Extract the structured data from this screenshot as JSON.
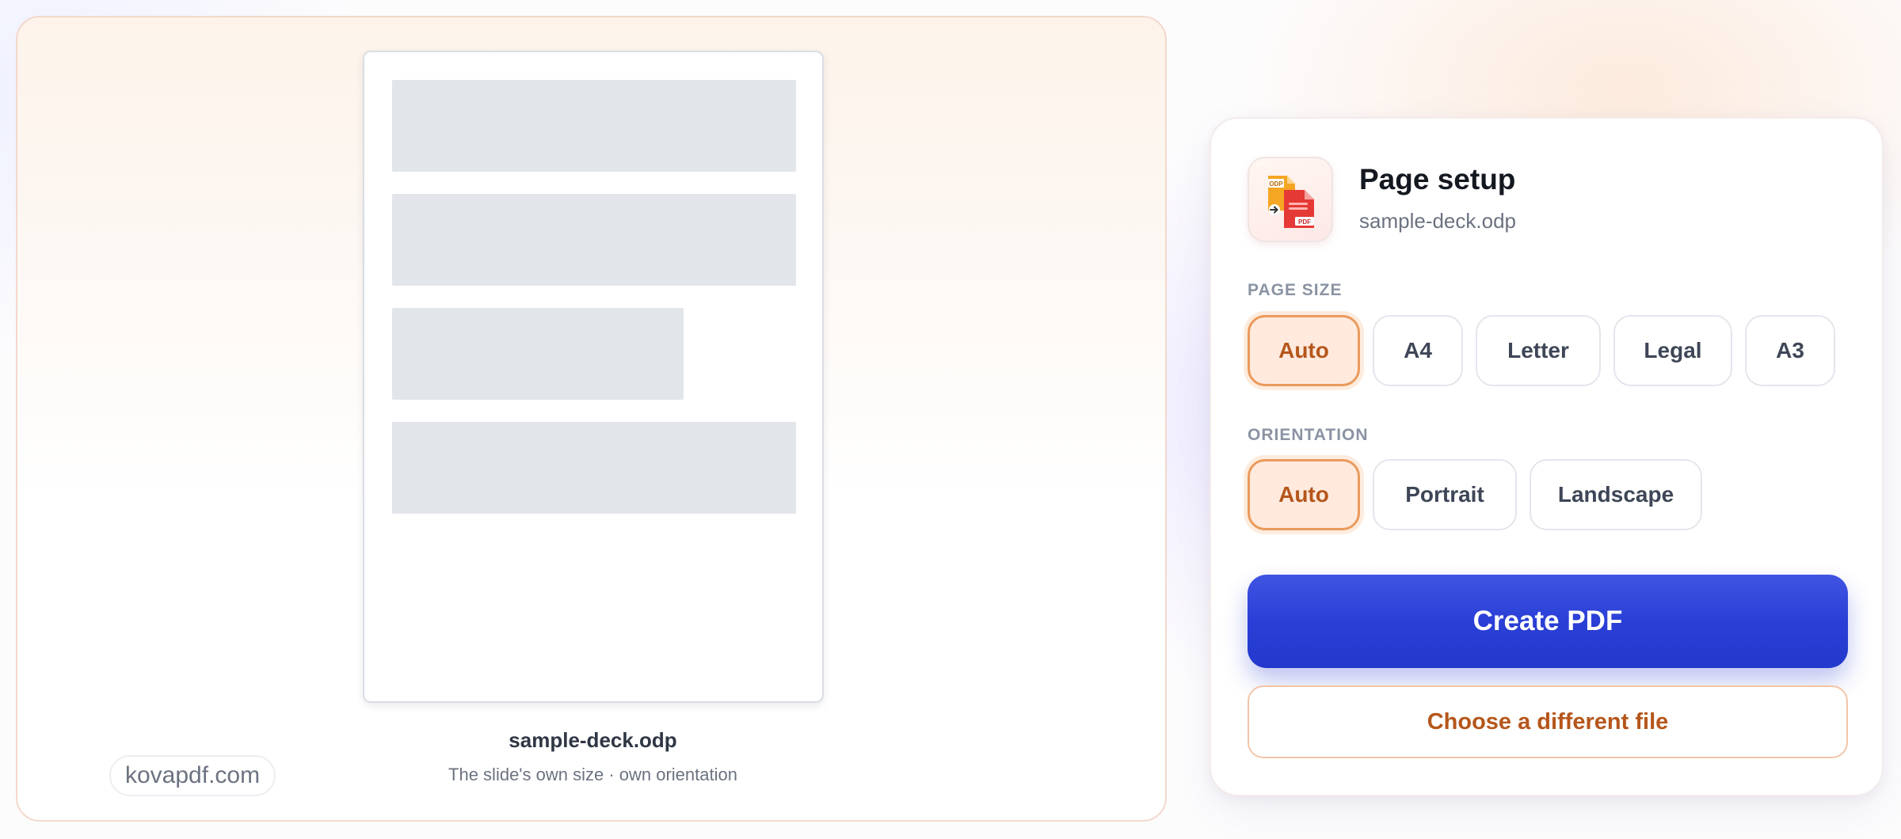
{
  "preview": {
    "filename": "sample-deck.odp",
    "subtitle": "The slide's own size · own orientation",
    "brand": "kovapdf.com"
  },
  "setup": {
    "title": "Page setup",
    "filename": "sample-deck.odp",
    "icon": {
      "name": "odp-to-pdf-icon",
      "source_badge": "ODP",
      "target_badge": "PDF",
      "colors": {
        "source": "#f5a623",
        "target": "#e53935"
      }
    },
    "page_size": {
      "label": "PAGE SIZE",
      "options": [
        "Auto",
        "A4",
        "Letter",
        "Legal",
        "A3"
      ],
      "selected": "Auto"
    },
    "orientation": {
      "label": "ORIENTATION",
      "options": [
        "Auto",
        "Portrait",
        "Landscape"
      ],
      "selected": "Auto"
    },
    "create_button": "Create PDF",
    "choose_button": "Choose a different file"
  },
  "colors": {
    "accent": "#2a3fd6",
    "selected_bg": "#ffeadd",
    "selected_text": "#b5561b"
  }
}
